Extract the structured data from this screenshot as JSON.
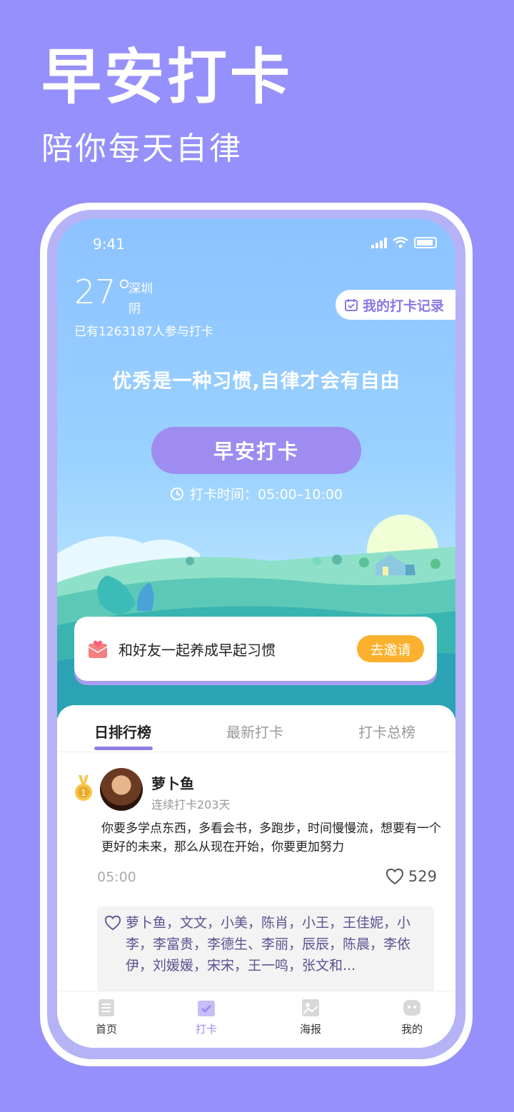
{
  "hero": {
    "title": "早安打卡",
    "subtitle": "陪你每天自律"
  },
  "status_bar": {
    "time": "9:41"
  },
  "weather": {
    "temperature": "27°",
    "city": "深圳",
    "condition": "阴"
  },
  "participants_text": "已有1263187人参与打卡",
  "record_button": {
    "label": "我的打卡记录"
  },
  "motto": "优秀是一种习惯,自律才会有自由",
  "checkin": {
    "button_label": "早安打卡",
    "time_text": "打卡时间：05:00–10:00"
  },
  "invite": {
    "text": "和好友一起养成早起习惯",
    "button_label": "去邀请"
  },
  "tabs": [
    {
      "label": "日排行榜",
      "active": true
    },
    {
      "label": "最新打卡",
      "active": false
    },
    {
      "label": "打卡总榜",
      "active": false
    }
  ],
  "post": {
    "rank": "1",
    "name": "萝卜鱼",
    "streak": "连续打卡203天",
    "text": "你要多学点东西，多看会书，多跑步，时间慢慢流，想要有一个更好的未来，那么从现在开始，你要更加努力",
    "time": "05:00",
    "likes": "529",
    "likers": "萝卜鱼，文文，小美，陈肖，小王，王佳妮，小李，李富贵，李德生、李丽，辰辰，陈晨，李依伊，刘媛媛，宋宋，王一鸣，张文和..."
  },
  "bottom_nav": [
    {
      "label": "首页",
      "icon": "document-icon",
      "active": false
    },
    {
      "label": "打卡",
      "icon": "calendar-check-icon",
      "active": true
    },
    {
      "label": "海报",
      "icon": "image-icon",
      "active": false
    },
    {
      "label": "我的",
      "icon": "face-icon",
      "active": false
    }
  ],
  "colors": {
    "background": "#9590fb",
    "accent": "#9e8cf0",
    "invite_button": "#fbb12d",
    "sky_top": "#8cc2ff"
  }
}
